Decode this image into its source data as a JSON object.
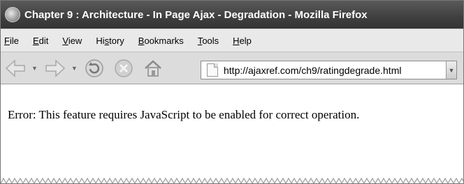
{
  "window": {
    "title": "Chapter 9 : Architecture - In Page Ajax - Degradation - Mozilla Firefox"
  },
  "menu": {
    "items": [
      {
        "label": "File"
      },
      {
        "label": "Edit"
      },
      {
        "label": "View"
      },
      {
        "label": "History"
      },
      {
        "label": "Bookmarks"
      },
      {
        "label": "Tools"
      },
      {
        "label": "Help"
      }
    ]
  },
  "toolbar": {
    "back_icon": "back-arrow-icon",
    "forward_icon": "forward-arrow-icon",
    "reload_icon": "reload-icon",
    "stop_icon": "stop-icon",
    "home_icon": "home-icon"
  },
  "address": {
    "url": "http://ajaxref.com/ch9/ratingdegrade.html"
  },
  "page": {
    "error_message": "Error: This feature requires JavaScript to be enabled for correct operation."
  }
}
